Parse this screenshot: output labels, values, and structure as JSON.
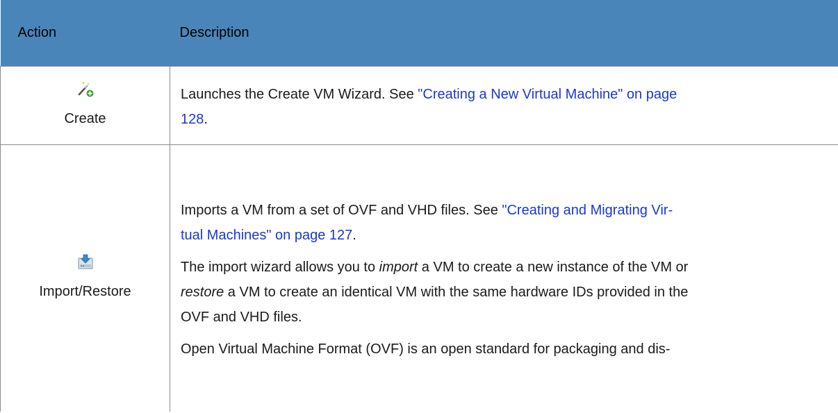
{
  "table": {
    "header": {
      "action": "Action",
      "description": "Description"
    },
    "rows": [
      {
        "action_label": "Create",
        "icon": "magic-wand-plus-icon",
        "description": {
          "text_before": "Launches the Create VM Wizard. See ",
          "link_line1": "\"Creating a New Virtual Machine\" on page",
          "link_line2": "128",
          "text_after": "."
        }
      },
      {
        "action_label": "Import/Restore",
        "icon": "import-restore-icon",
        "description": {
          "p1": {
            "text_before": "Imports a VM from a set of OVF and VHD files. See ",
            "link_line1": "\"Creating and Migrating Vir-",
            "link_line2": "tual Machines\" on page 127",
            "text_after": "."
          },
          "p2": {
            "line1_em": "import",
            "line1_pre": "The import wizard allows you to ",
            "line1_post": " a VM to create a new instance of the VM or",
            "line2_em": "restore",
            "line2_post": " a VM to create an identical VM with the same hardware IDs provided in the",
            "line3": "OVF and VHD files."
          },
          "p3": "Open Virtual Machine Format (OVF) is an open standard for packaging and dis-"
        }
      }
    ]
  },
  "colors": {
    "header_bg": "#4a85b9",
    "link": "#1a37d6",
    "border": "#8a8a8a"
  }
}
